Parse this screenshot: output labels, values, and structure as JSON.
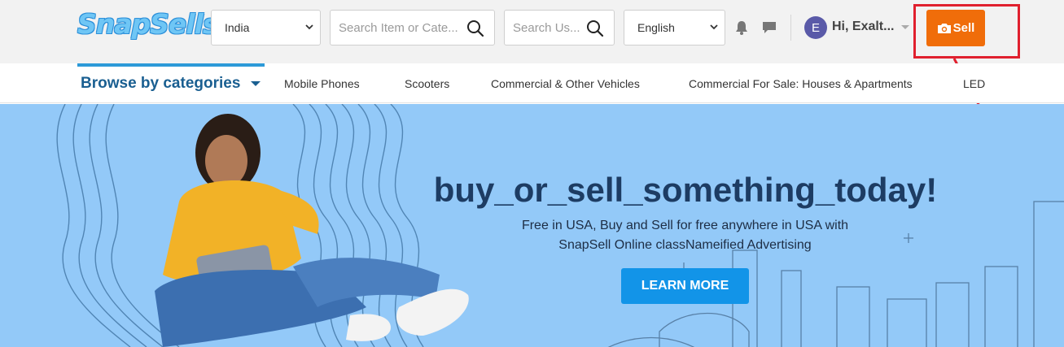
{
  "header": {
    "logo": "SnapSells",
    "country_select": {
      "value": "India"
    },
    "item_search": {
      "placeholder": "Search Item or Cate..."
    },
    "user_search": {
      "placeholder": "Search Us..."
    },
    "language_select": {
      "value": "English"
    },
    "user": {
      "avatar_initial": "E",
      "greeting": "Hi, Exalt..."
    },
    "sell_button": {
      "label": "Sell"
    },
    "colors": {
      "sell": "#f06d0a",
      "highlight": "#e0202e",
      "logo": "#6fc6f5"
    }
  },
  "category_bar": {
    "browse_label": "Browse by categories",
    "items": [
      "Mobile Phones",
      "Scooters",
      "Commercial & Other Vehicles",
      "Commercial For Sale: Houses & Apartments",
      "LED"
    ]
  },
  "hero": {
    "title": "buy_or_sell_something_today!",
    "subtitle_line1": "Free in USA, Buy and Sell for free anywhere in USA with",
    "subtitle_line2": "SnapSell Online classNameified Advertising",
    "cta_label": "LEARN MORE",
    "colors": {
      "background": "#93c9f8",
      "title": "#1d3c63",
      "cta": "#1294e8"
    }
  },
  "icons": {
    "notifications": "bell-icon",
    "messages": "chat-icon",
    "search": "search-icon",
    "camera": "camera-icon"
  }
}
